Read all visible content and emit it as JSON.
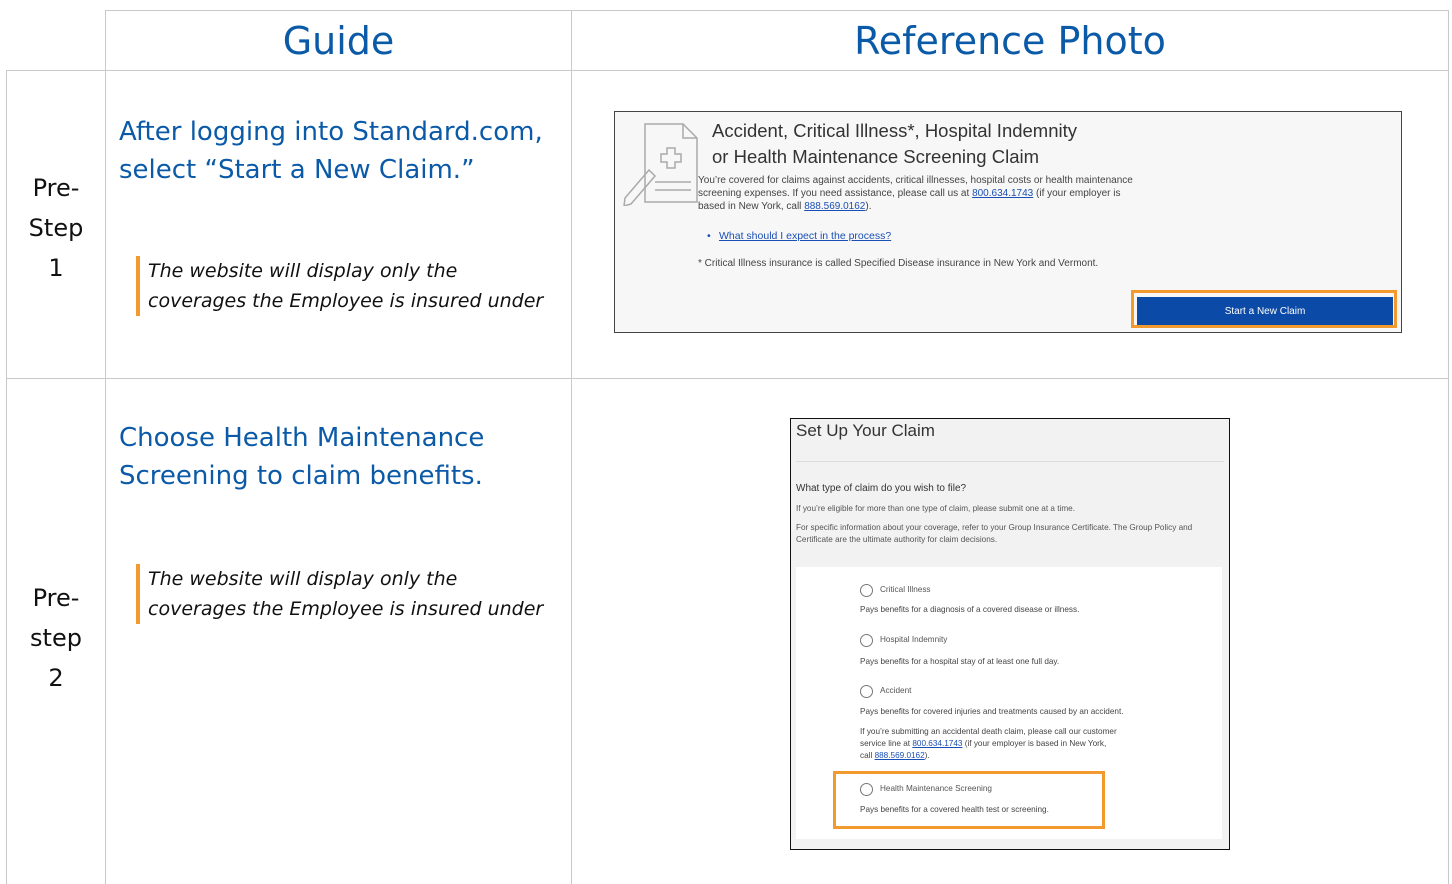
{
  "headers": {
    "guide": "Guide",
    "reference": "Reference Photo"
  },
  "rows": [
    {
      "step_label": [
        "Pre-",
        "Step",
        "1"
      ],
      "title_lines": [
        "After logging into Standard.com,",
        "select “Start a New Claim.”"
      ],
      "note_lines": [
        "The website will display only the",
        "coverages the Employee is insured under"
      ]
    },
    {
      "step_label": [
        "Pre-",
        "step",
        "2"
      ],
      "title_lines": [
        "Choose Health Maintenance",
        "Screening to claim benefits."
      ],
      "note_lines": [
        "The website will display only the",
        "coverages the Employee is insured under"
      ]
    }
  ],
  "ref1": {
    "title_lines": [
      "Accident, Critical Illness*, Hospital Indemnity",
      "or Health Maintenance Screening Claim"
    ],
    "para_a": "You’re covered for claims against accidents, critical illnesses, hospital costs or health maintenance screening expenses. If you need assistance, please call us at",
    "phone1": "800.634.1743",
    "para_b": "(if your employer is based in New York, call",
    "phone2": "888.569.0162",
    "para_c": ").",
    "link": "What should I expect in the process?",
    "footnote": "* Critical Illness insurance is called Specified Disease insurance in New York and Vermont.",
    "button": "Start a New Claim"
  },
  "ref2": {
    "title": "Set Up Your Claim",
    "question": "What type of claim do you wish to file?",
    "info1": "If you’re eligible for more than one type of claim, please submit one at a time.",
    "info2": "For specific information about your coverage, refer to your Group Insurance Certificate. The Group Policy and Certificate are the ultimate authority for claim decisions.",
    "options": [
      {
        "label": "Critical Illness",
        "desc": "Pays benefits for a diagnosis of a covered disease or illness."
      },
      {
        "label": "Hospital Indemnity",
        "desc": "Pays benefits for a hospital stay of at least one full day."
      },
      {
        "label": "Accident",
        "desc": "Pays benefits for covered injuries and treatments caused by an accident."
      },
      {
        "label": "Health Maintenance Screening",
        "desc": "Pays benefits for a covered health test or screening."
      }
    ],
    "accident_extra": {
      "line1": "If you’re submitting an accidental death claim, please call our customer",
      "line2a": "service line at",
      "phone1": "800.634.1743",
      "line2b": "(if your employer is based in New York,",
      "line3a": "call",
      "phone2": "888.569.0162",
      "line3b": ")."
    }
  }
}
